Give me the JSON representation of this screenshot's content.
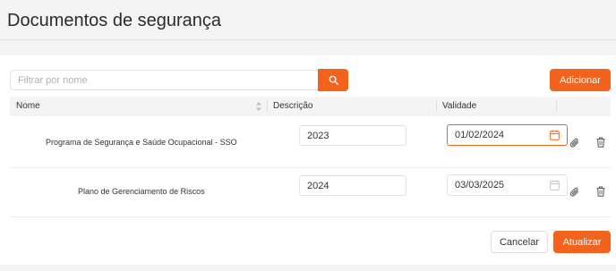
{
  "page": {
    "title": "Documentos de segurança"
  },
  "toolbar": {
    "search_placeholder": "Filtrar por nome",
    "search_icon": "search-icon",
    "add_label": "Adicionar"
  },
  "table": {
    "columns": [
      "Nome",
      "Descrição",
      "Validade"
    ],
    "rows": [
      {
        "name": "Programa de Segurança e Saúde Ocupacional - SSO",
        "description": "2023",
        "validity": "01/02/2024"
      },
      {
        "name": "Plano de Gerenciamento de Riscos",
        "description": "2024",
        "validity": "03/03/2025"
      }
    ]
  },
  "footer": {
    "cancel_label": "Cancelar",
    "update_label": "Atualizar"
  },
  "colors": {
    "accent": "#f4631e",
    "icon_gray": "#555555"
  }
}
